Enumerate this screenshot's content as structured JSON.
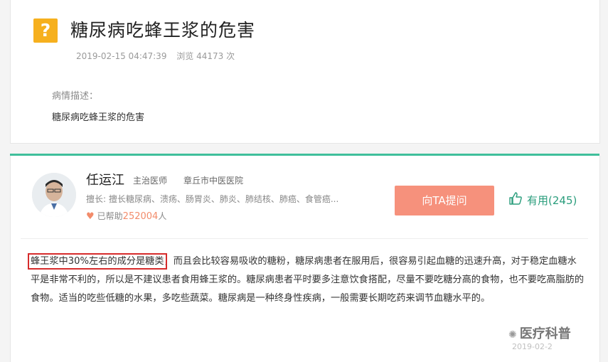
{
  "question": {
    "icon": "?",
    "title": "糖尿病吃蜂王浆的危害",
    "datetime": "2019-02-15 04:47:39",
    "views_label": "浏览 44173 次",
    "desc_label": "病情描述：",
    "desc_text": "糖尿病吃蜂王浆的危害"
  },
  "doctor": {
    "name": "任运江",
    "title": "主治医师",
    "hospital": "章丘市中医医院",
    "specialty": "擅长: 擅长糖尿病、溃疡、肠胃炎、肺炎、肺结核、肺癌、食管癌...",
    "helped_prefix": "已帮助",
    "helped_count": "252004",
    "helped_suffix": "人",
    "ask_button": "向TA提问",
    "useful_label": "有用(245)"
  },
  "answer": {
    "highlight": "蜂王浆中30%左右的成分是糖类",
    "rest": "，而且会比较容易吸收的糖粉，糖尿病患者在服用后，很容易引起血糖的迅速升高，对于稳定血糖水平是非常不利的，所以是不建议患者食用蜂王浆的。糖尿病患者平时要多注意饮食搭配，尽量不要吃糖分高的食物，也不要吃高脂肪的食物。适当的吃些低糖的水果，多吃些蔬菜。糖尿病是一种终身性疾病，一般需要长期吃药来调节血糖水平的。"
  },
  "footer": {
    "watermark": "医疗科普",
    "date": "2019-02-2"
  },
  "colors": {
    "accent_green": "#3fbf9b",
    "button_orange": "#f6917c",
    "highlight_red": "#d62b2b",
    "icon_yellow": "#f6b01e"
  }
}
